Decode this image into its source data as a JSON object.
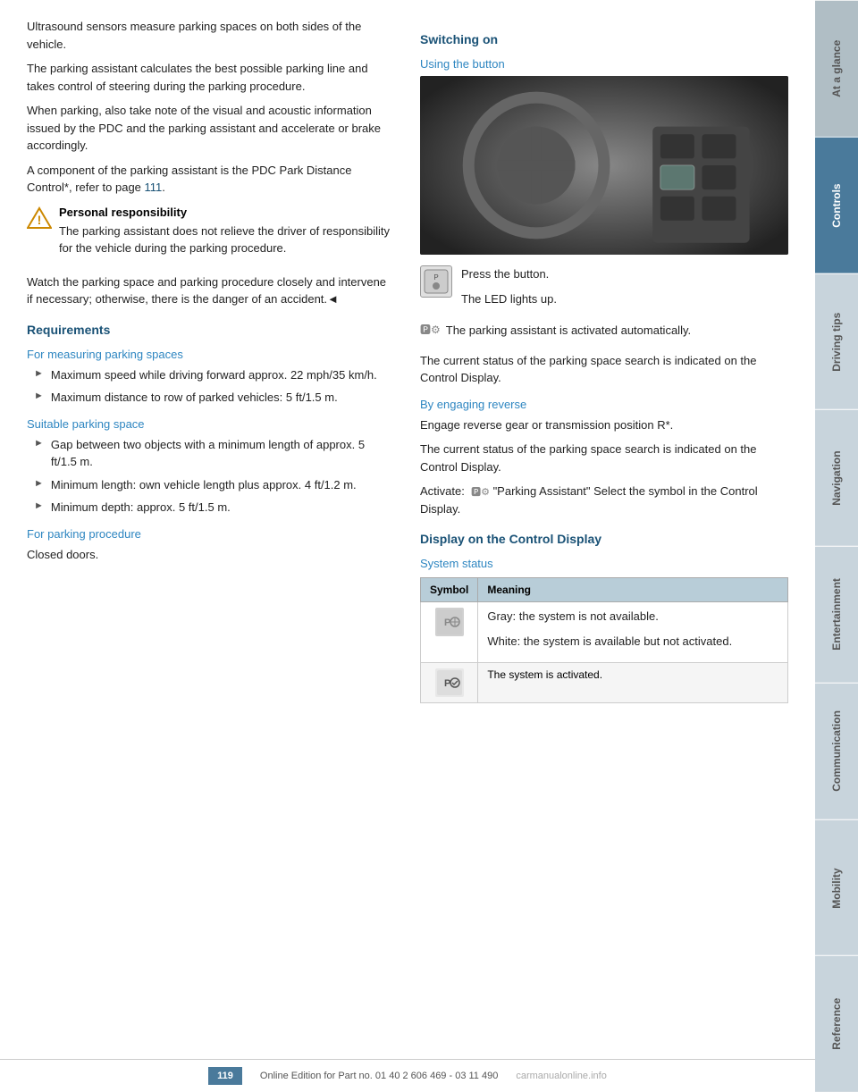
{
  "sidebar": {
    "tabs": [
      {
        "label": "At a glance",
        "active": false
      },
      {
        "label": "Controls",
        "active": true
      },
      {
        "label": "Driving tips",
        "active": false
      },
      {
        "label": "Navigation",
        "active": false
      },
      {
        "label": "Entertainment",
        "active": false
      },
      {
        "label": "Communication",
        "active": false
      },
      {
        "label": "Mobility",
        "active": false
      },
      {
        "label": "Reference",
        "active": false
      }
    ]
  },
  "left": {
    "intro_p1": "Ultrasound sensors measure parking spaces on both sides of the vehicle.",
    "intro_p2": "The parking assistant calculates the best possible parking line and takes control of steering during the parking procedure.",
    "intro_p3": "When parking, also take note of the visual and acoustic information issued by the PDC and the parking assistant and accelerate or brake accordingly.",
    "intro_p4": "A component of the parking assistant is the PDC Park Distance Control*, refer to page 111.",
    "warning_title": "Personal responsibility",
    "warning_body": "The parking assistant does not relieve the driver of responsibility for the vehicle during the parking procedure.",
    "warning_note": "Watch the parking space and parking procedure closely and intervene if necessary; otherwise, there is the danger of an accident.◄",
    "requirements_heading": "Requirements",
    "for_measuring_heading": "For measuring parking spaces",
    "bullet1": "Maximum speed while driving forward approx. 22 mph/35 km/h.",
    "bullet2": "Maximum distance to row of parked vehicles: 5 ft/1.5 m.",
    "suitable_parking_heading": "Suitable parking space",
    "bullet3": "Gap between two objects with a minimum length of approx. 5 ft/1.5 m.",
    "bullet4": "Minimum length: own vehicle length plus approx. 4 ft/1.2 m.",
    "bullet5": "Minimum depth: approx. 5 ft/1.5 m.",
    "for_parking_heading": "For parking procedure",
    "closed_doors": "Closed doors."
  },
  "right": {
    "switching_on_heading": "Switching on",
    "using_button_heading": "Using the button",
    "press_button": "Press the button.",
    "led_lights": "The LED lights up.",
    "auto_activate": "The parking assistant is activated automatically.",
    "current_status_1": "The current status of the parking space search is indicated on the Control Display.",
    "by_engaging_heading": "By engaging reverse",
    "engage_reverse": "Engage reverse gear or transmission position R*.",
    "current_status_2": "The current status of the parking space search is indicated on the Control Display.",
    "activate_note": "Activate:  \"Parking Assistant\" Select the symbol in the Control Display.",
    "display_heading": "Display on the Control Display",
    "system_status_heading": "System status",
    "table_col1": "Symbol",
    "table_col2": "Meaning",
    "row1_meaning1": "Gray: the system is not available.",
    "row1_meaning2": "White: the system is available but not activated.",
    "row2_meaning": "The system is activated."
  },
  "footer": {
    "page_number": "119",
    "footer_text": "Online Edition for Part no. 01 40 2 606 469 - 03 11 490",
    "watermark": "carmanualonline.info"
  }
}
